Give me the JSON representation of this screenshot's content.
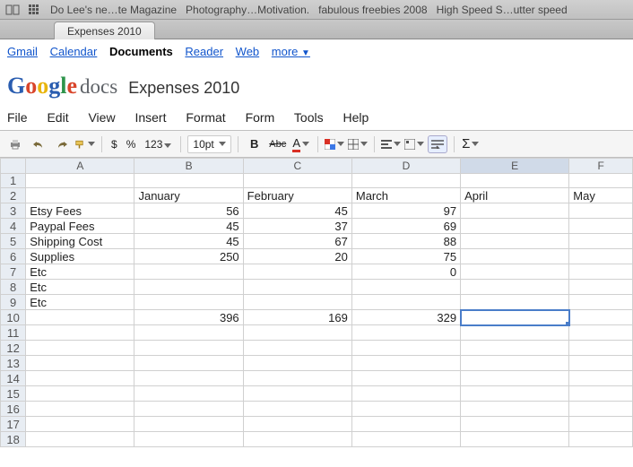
{
  "browser": {
    "bookmarks": [
      "Do Lee's ne…te Magazine",
      "Photography…Motivation.",
      "fabulous freebies 2008",
      "High Speed S…utter speed"
    ],
    "tab_title": "Expenses 2010"
  },
  "google_bar": {
    "links": [
      "Gmail",
      "Calendar",
      "Documents",
      "Reader",
      "Web",
      "more"
    ],
    "active_index": 2
  },
  "logo_text": {
    "g1": "G",
    "o1": "o",
    "o2": "o",
    "g2": "g",
    "l": "l",
    "e": "e",
    "docs": "docs"
  },
  "doc_title": "Expenses 2010",
  "menus": [
    "File",
    "Edit",
    "View",
    "Insert",
    "Format",
    "Form",
    "Tools",
    "Help"
  ],
  "toolbar": {
    "currency": "$",
    "percent": "%",
    "num_format": "123",
    "font_size": "10pt",
    "bold": "B",
    "strike": "Abc",
    "text_color": "A"
  },
  "chart_data": {
    "type": "table",
    "columns": [
      "A",
      "B",
      "C",
      "D",
      "E",
      "F"
    ],
    "header_cells": {
      "B": "January",
      "C": "February",
      "D": "March",
      "E": "April",
      "F": "May"
    },
    "rows": [
      {
        "label": "Etsy Fees",
        "values": {
          "B": 56,
          "C": 45,
          "D": 97
        }
      },
      {
        "label": "Paypal Fees",
        "values": {
          "B": 45,
          "C": 37,
          "D": 69
        }
      },
      {
        "label": "Shipping Cost",
        "values": {
          "B": 45,
          "C": 67,
          "D": 88
        }
      },
      {
        "label": "Supplies",
        "values": {
          "B": 250,
          "C": 20,
          "D": 75
        }
      },
      {
        "label": "Etc",
        "values": {
          "D": 0
        }
      },
      {
        "label": "Etc",
        "values": {}
      },
      {
        "label": "Etc",
        "values": {}
      }
    ],
    "totals": {
      "B": 396,
      "C": 169,
      "D": 329
    },
    "selected_cell": "E10"
  }
}
